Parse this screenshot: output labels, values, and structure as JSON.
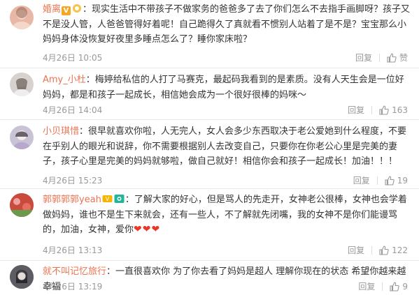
{
  "comments": [
    {
      "username": "婚离",
      "text": "现实生活中不带孩子不做家务的爸爸多了去了你们怎么不去指手画脚呀？孩子又不是没人管，人爸爸管得好着呢！自己跪得久了真就看不惯别人站着了是不是？宝宝那么小妈妈身体没恢复好夜里多睡点怎么了？睡你家床啦？",
      "time": "4月26日 10:05",
      "reply_label": "回复",
      "like_label": "赞",
      "avatar_color": "#e8b7a6"
    },
    {
      "username": "Amy_小杜",
      "text": "梅婷给私信的人打了马赛克，最起码我看到的是素质。没有人天生会是一位好妈妈，都是和孩子一起成长，相信她会成为一个很好很棒的妈咪～",
      "time": "4月26日 14:04",
      "reply_label": "回复",
      "like_count": "163",
      "avatar_color": "#d8d2cf"
    },
    {
      "username": "小贝琪惜",
      "text": "很早就喜欢你啦，人无完人，女人会多少东西取决于老公爱她到什么程度，不要在乎别人的眼光和说辞，你不需要根据别人去改变自己，只要你在你老公心里是完美的妻子，孩子心里是完美的妈妈就够啦，做自己就好！相信你会和孩子一起成长！加油！！！",
      "time": "4月26日 15:23",
      "reply_label": "回复",
      "like_count": "19",
      "avatar_color": "#c9c3d6"
    },
    {
      "username": "郭郭郭郭yeah",
      "text": "了解大家的好心，但是骂人的先走开，女神老公很棒，女神也会学着做妈妈，谁也不是生下来就会，还有一些人，不了解就先闭嘴，我的女神不是你们能谩骂的，加油，女神，爱你",
      "hearts": "❤❤❤",
      "time": "4月26日 13:13",
      "reply_label": "回复",
      "like_count": "122",
      "avatar_color": "#d86a5a"
    },
    {
      "username": "就不叫记忆旅行",
      "text": "一直很喜欢你 为了你去看了妈妈是超人 理解你现在的状态 希望你越来越幸福",
      "time": "4月26日 13:19",
      "reply_label": "回复",
      "like_count": "9",
      "avatar_color": "#6b6a70"
    }
  ]
}
